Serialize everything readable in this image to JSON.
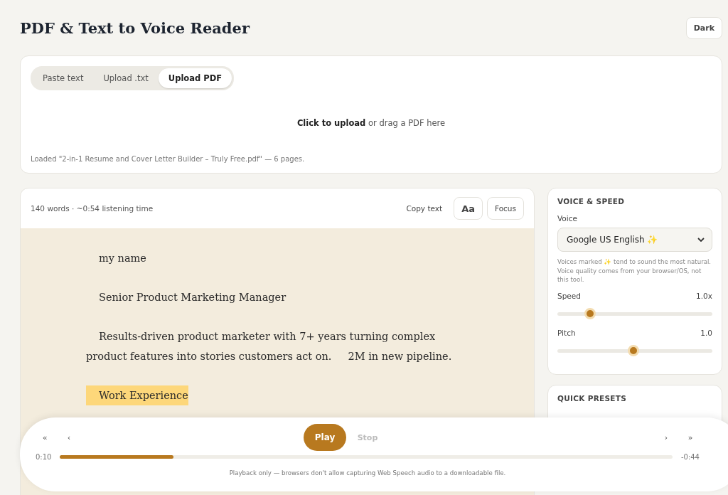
{
  "header": {
    "title": "PDF & Text to Voice Reader",
    "theme_button": "Dark"
  },
  "source": {
    "tabs": [
      {
        "label": "Paste text",
        "selected": false
      },
      {
        "label": "Upload .txt",
        "selected": false
      },
      {
        "label": "Upload PDF",
        "selected": true
      }
    ],
    "dropzone": "**Click to upload** or drag a PDF here",
    "status": "Loaded \"2-in-1 Resume and Cover Letter Builder – Truly Free.pdf\" — 6 pages."
  },
  "reader": {
    "stats": "140 words · ~0:54 listening time",
    "actions": [
      "Copy text",
      "Aa",
      "Focus"
    ],
    "paragraphs": [
      {
        "text": "my name",
        "highlighted": false
      },
      {
        "text": "Senior Product Marketing Manager",
        "highlighted": false
      },
      {
        "text": "Results-driven product marketer with 7+ years turning complex product features into stories customers act on.     2M in new pipeline.",
        "highlighted": false
      },
      {
        "text": "Work Experience",
        "highlighted": true
      }
    ]
  },
  "voice_panel": {
    "heading": "VOICE & SPEED",
    "voice_label": "Voice",
    "voice_value": "Google US English ✨",
    "hint": "Voices marked ✨ tend to sound the most natural. Voice quality comes from your browser/OS, not this tool.",
    "sliders": [
      {
        "label": "Speed",
        "reading": "1.0x",
        "level": 0.21
      },
      {
        "label": "Pitch",
        "reading": "1.0",
        "level": 0.49
      }
    ]
  },
  "presets_panel": {
    "heading": "QUICK PRESETS"
  },
  "player": {
    "buttons": [
      "«",
      "‹",
      "Play",
      "Stop",
      "›",
      "»"
    ],
    "elapsed": "0:10",
    "remaining": "-0:44",
    "level": 0.185,
    "note": "Playback only — browsers don't allow capturing Web Speech audio to a downloadable file."
  }
}
